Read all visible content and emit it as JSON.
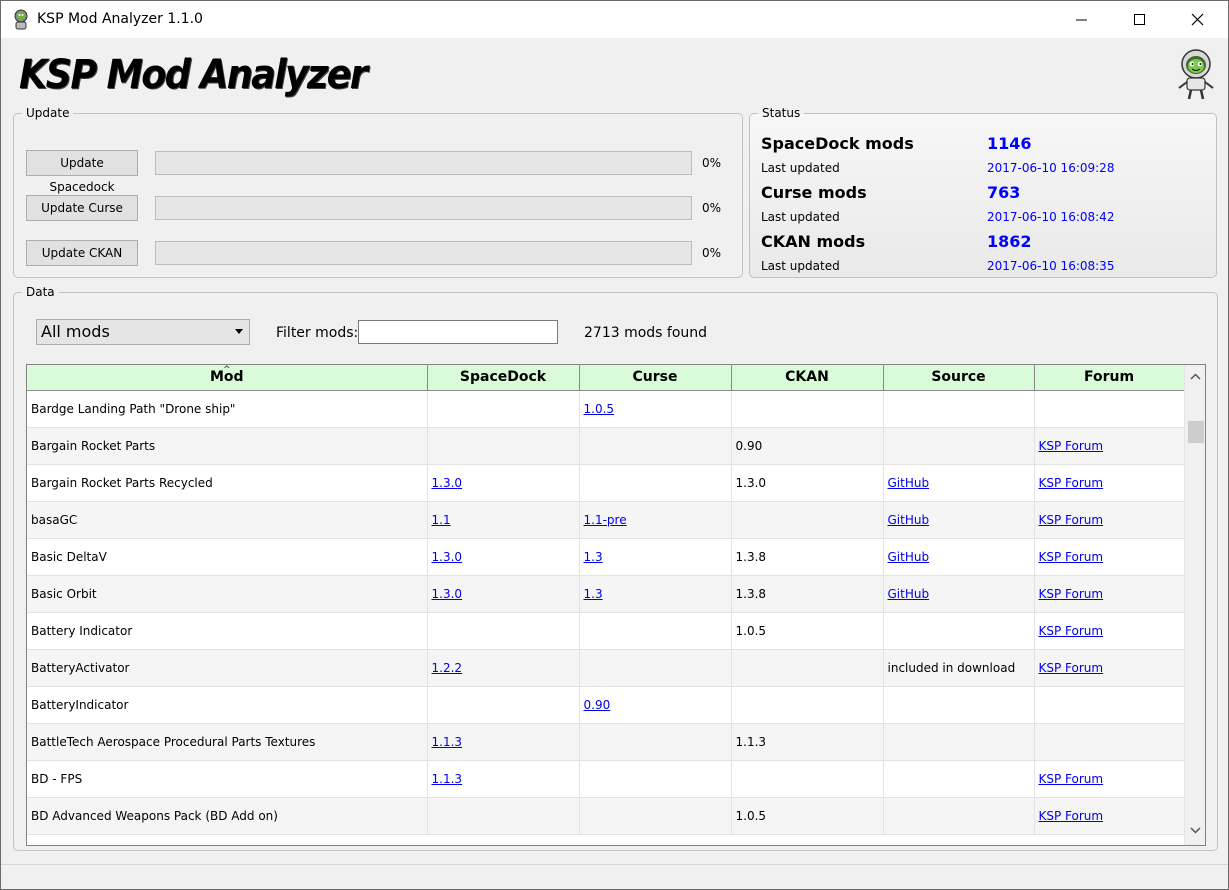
{
  "window": {
    "title": "KSP Mod Analyzer 1.1.0"
  },
  "logo": {
    "text": "KSP Mod Analyzer"
  },
  "update": {
    "legend": "Update",
    "rows": [
      {
        "button": "Update Spacedock",
        "progress": 0,
        "percent": "0%"
      },
      {
        "button": "Update Curse",
        "progress": 0,
        "percent": "0%"
      },
      {
        "button": "Update CKAN",
        "progress": 0,
        "percent": "0%"
      }
    ]
  },
  "status": {
    "legend": "Status",
    "last_updated_label": "Last updated",
    "sources": [
      {
        "name": "SpaceDock mods",
        "count": "1146",
        "date": "2017-06-10 16:09:28"
      },
      {
        "name": "Curse mods",
        "count": "763",
        "date": "2017-06-10 16:08:42"
      },
      {
        "name": "CKAN mods",
        "count": "1862",
        "date": "2017-06-10 16:08:35"
      }
    ],
    "accent_color": "#0000ff"
  },
  "data": {
    "legend": "Data",
    "filter_select": "All mods",
    "filter_label": "Filter mods:",
    "filter_value": "",
    "found_text": "2713 mods found",
    "columns": [
      "Mod",
      "SpaceDock",
      "Curse",
      "CKAN",
      "Source",
      "Forum"
    ],
    "header_color": "#d9fbd9",
    "rows": [
      [
        "Bardge Landing Path \"Drone ship\"",
        "",
        "1.0.5",
        "",
        "",
        ""
      ],
      [
        "Bargain Rocket Parts",
        "",
        "",
        "0.90",
        "",
        "KSP Forum"
      ],
      [
        "Bargain Rocket Parts Recycled",
        "1.3.0",
        "",
        "1.3.0",
        "GitHub",
        "KSP Forum"
      ],
      [
        "basaGC",
        "1.1",
        "1.1-pre",
        "",
        "GitHub",
        "KSP Forum"
      ],
      [
        "Basic DeltaV",
        "1.3.0",
        "1.3",
        "1.3.8",
        "GitHub",
        "KSP Forum"
      ],
      [
        "Basic Orbit",
        "1.3.0",
        "1.3",
        "1.3.8",
        "GitHub",
        "KSP Forum"
      ],
      [
        "Battery Indicator",
        "",
        "",
        "1.0.5",
        "",
        "KSP Forum"
      ],
      [
        "BatteryActivator",
        "1.2.2",
        "",
        "",
        "included in download",
        "KSP Forum"
      ],
      [
        "BatteryIndicator",
        "",
        "0.90",
        "",
        "",
        ""
      ],
      [
        "BattleTech Aerospace Procedural Parts Textures",
        "1.1.3",
        "",
        "1.1.3",
        "",
        ""
      ],
      [
        "BD - FPS",
        "1.1.3",
        "",
        "",
        "",
        "KSP Forum"
      ],
      [
        "BD Advanced Weapons Pack (BD Add on)",
        "",
        "",
        "1.0.5",
        "",
        "KSP Forum"
      ]
    ]
  }
}
